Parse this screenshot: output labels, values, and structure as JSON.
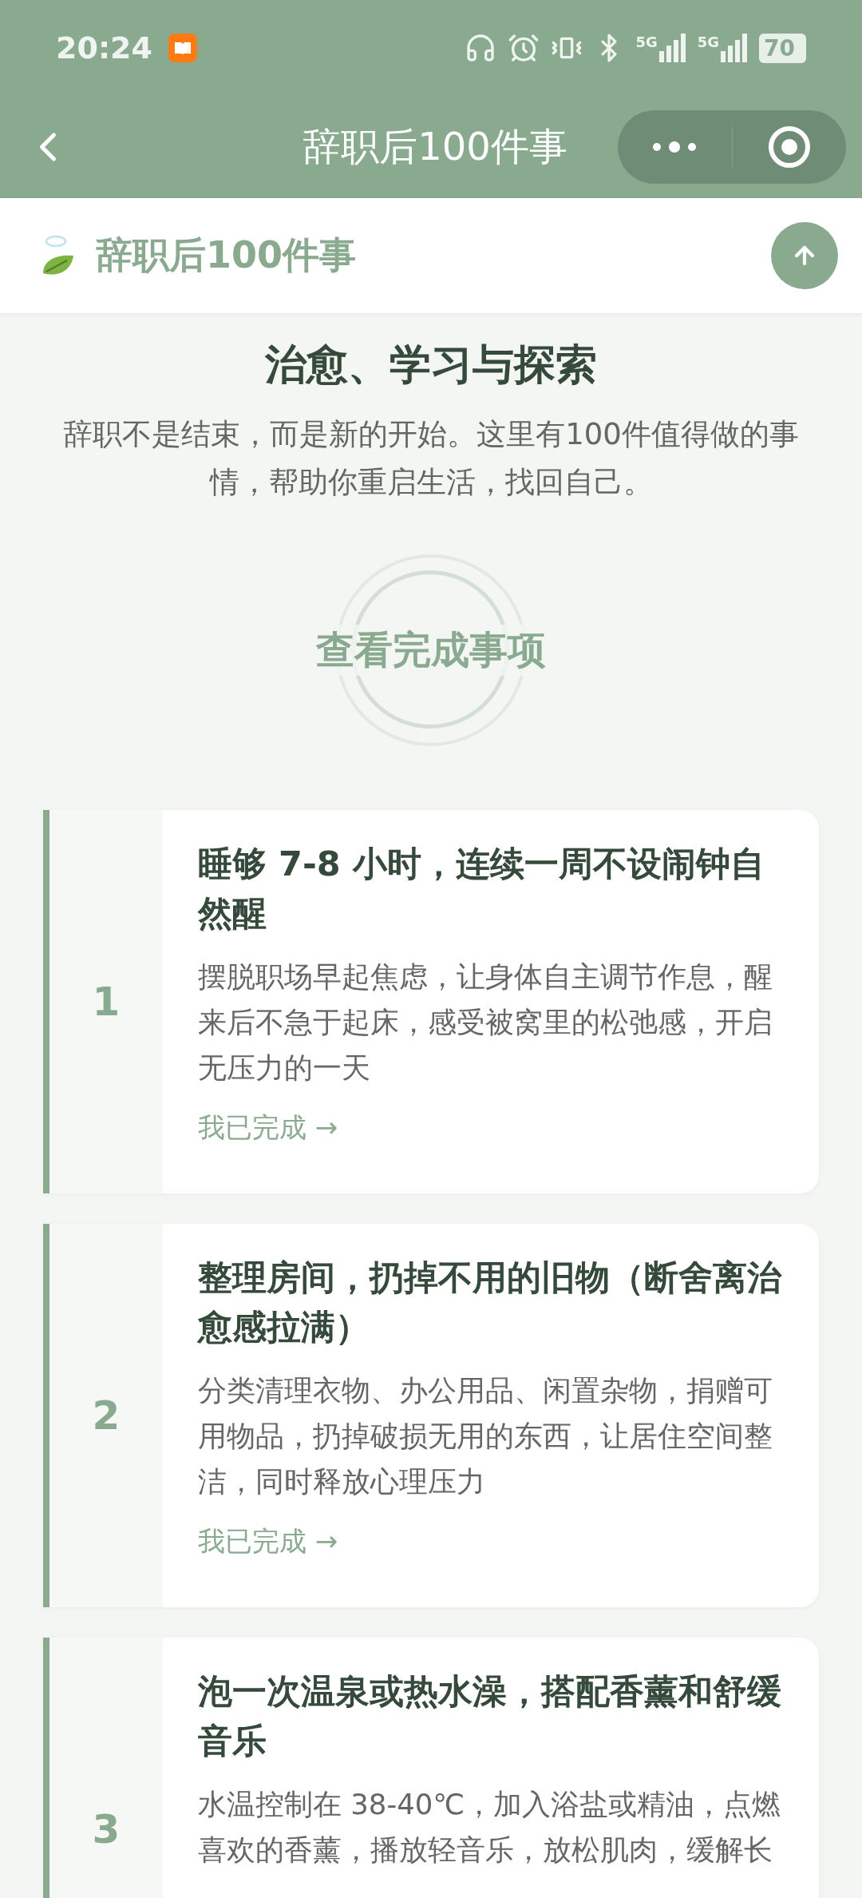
{
  "status_bar": {
    "time": "20:24",
    "network_1": "5G",
    "network_2": "5G",
    "battery": "70"
  },
  "nav_bar": {
    "title": "辞职后100件事"
  },
  "header": {
    "title": "辞职后100件事"
  },
  "intro": {
    "title": "治愈、学习与探索",
    "subtitle": "辞职不是结束，而是新的开始。这里有100件值得做的事情，帮助你重启生活，找回自己。"
  },
  "completed_button": {
    "label": "查看完成事项"
  },
  "items": [
    {
      "number": "1",
      "title": "睡够 7-8 小时，连续一周不设闹钟自然醒",
      "description": "摆脱职场早起焦虑，让身体自主调节作息，醒来后不急于起床，感受被窝里的松弛感，开启无压力的一天",
      "action": "我已完成 →"
    },
    {
      "number": "2",
      "title": "整理房间，扔掉不用的旧物（断舍离治愈感拉满）",
      "description": "分类清理衣物、办公用品、闲置杂物，捐赠可用物品，扔掉破损无用的东西，让居住空间整洁，同时释放心理压力",
      "action": "我已完成 →"
    },
    {
      "number": "3",
      "title": "泡一次温泉或热水澡，搭配香薰和舒缓音乐",
      "description": "水温控制在 38-40℃，加入浴盐或精油，点燃喜欢的香薰，播放轻音乐，放松肌肉，缓解长"
    }
  ]
}
